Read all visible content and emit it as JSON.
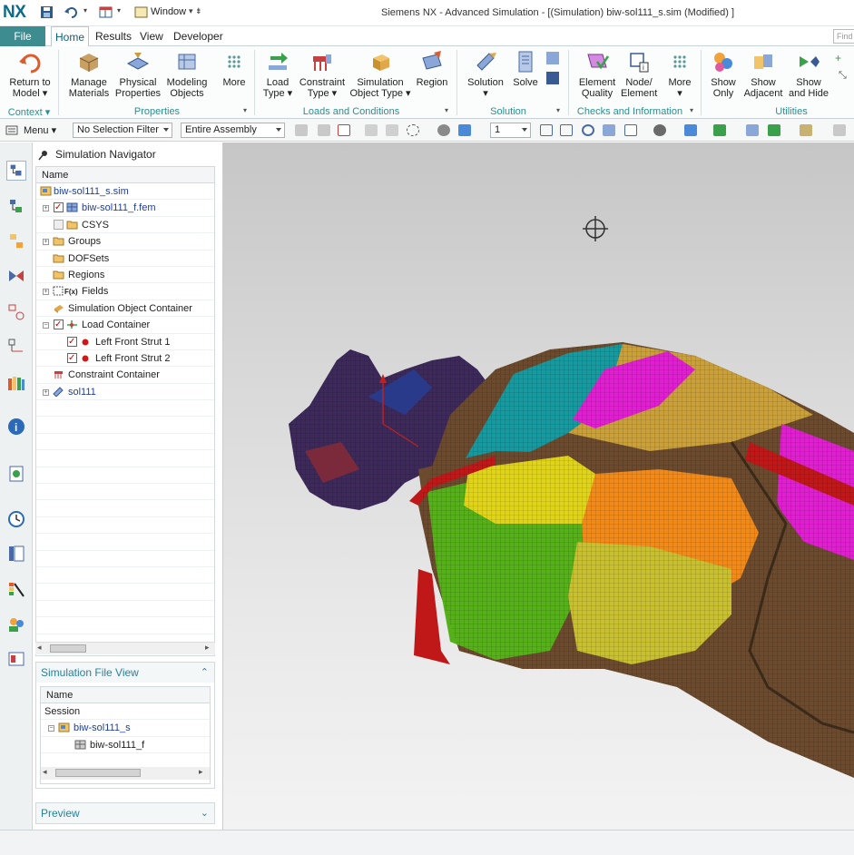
{
  "app": {
    "logo": "NX",
    "window_title": "Siemens NX - Advanced Simulation - [(Simulation) biw-sol111_s.sim (Modified) ]",
    "window_menu": "Window"
  },
  "tabs": [
    {
      "label": "File"
    },
    {
      "label": "Home"
    },
    {
      "label": "Results"
    },
    {
      "label": "View"
    },
    {
      "label": "Developer"
    }
  ],
  "find_placeholder": "Find",
  "ribbon": {
    "buttons": [
      {
        "label": "Return to\nModel ▾",
        "icon": "return-to-model-icon"
      },
      {
        "label": "Manage\nMaterials",
        "icon": "manage-materials-icon"
      },
      {
        "label": "Physical\nProperties",
        "icon": "physical-properties-icon"
      },
      {
        "label": "Modeling\nObjects",
        "icon": "modeling-objects-icon"
      },
      {
        "label": "More",
        "icon": "more-grid-icon"
      },
      {
        "label": "Load\nType ▾",
        "icon": "load-type-icon"
      },
      {
        "label": "Constraint\nType ▾",
        "icon": "constraint-type-icon"
      },
      {
        "label": "Simulation\nObject Type ▾",
        "icon": "simulation-object-type-icon"
      },
      {
        "label": "Region",
        "icon": "region-icon"
      },
      {
        "label": "Solution\n▾",
        "icon": "solution-icon"
      },
      {
        "label": "Solve",
        "icon": "solve-icon"
      },
      {
        "label": "Element\nQuality",
        "icon": "element-quality-icon"
      },
      {
        "label": "Node/\nElement",
        "icon": "node-element-icon"
      },
      {
        "label": "More\n▾",
        "icon": "more-grid-icon"
      },
      {
        "label": "Show\nOnly",
        "icon": "show-only-icon"
      },
      {
        "label": "Show\nAdjacent",
        "icon": "show-adjacent-icon"
      },
      {
        "label": "Show\nand Hide",
        "icon": "show-and-hide-icon"
      }
    ],
    "groups": [
      "Context ▾",
      "Properties",
      "Loads and Conditions",
      "Solution",
      "Checks and Information",
      "Utilities"
    ]
  },
  "toolbar": {
    "menu_label": "Menu ▾",
    "selection_filter": "No Selection Filter",
    "scope": "Entire Assembly",
    "layer": "1"
  },
  "navigator": {
    "title": "Simulation Navigator",
    "column": "Name",
    "tree": [
      {
        "label": "biw-sol111_s.sim",
        "link": true
      },
      {
        "label": "biw-sol111_f.fem",
        "link": true
      },
      {
        "label": "CSYS"
      },
      {
        "label": "Groups"
      },
      {
        "label": "DOFSets"
      },
      {
        "label": "Regions"
      },
      {
        "label": "Fields"
      },
      {
        "label": "Simulation Object Container"
      },
      {
        "label": "Load Container"
      },
      {
        "label": "Left Front Strut 1"
      },
      {
        "label": "Left Front Strut 2"
      },
      {
        "label": "Constraint Container"
      },
      {
        "label": "sol111",
        "link": true
      }
    ]
  },
  "file_view": {
    "title": "Simulation File View",
    "column": "Name",
    "rows": [
      {
        "label": "Session"
      },
      {
        "label": "biw-sol111_s",
        "link": true
      },
      {
        "label": "biw-sol111_f"
      }
    ]
  },
  "preview": {
    "title": "Preview"
  },
  "colors": {
    "accent": "#3d8c8f",
    "link": "#1f3e9e",
    "group_label": "#2c8f8f"
  }
}
